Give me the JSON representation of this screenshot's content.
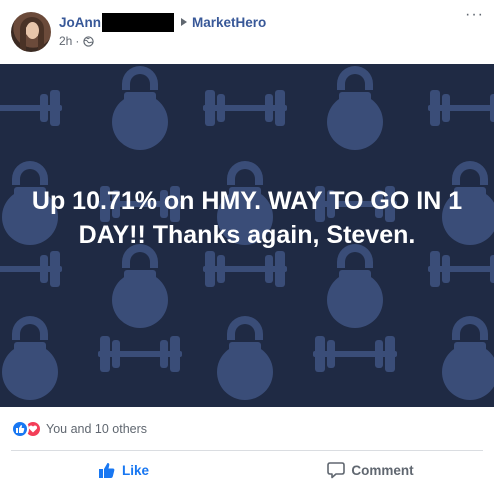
{
  "post": {
    "author": "JoAnn",
    "arrow": "▸",
    "group": "MarketHero",
    "time": "2h",
    "separator": "·",
    "more_menu": "···",
    "banner_text": "Up 10.71% on HMY. WAY TO GO IN 1 DAY!! Thanks again, Steven.",
    "reactions_text": "You and 10 others",
    "like_label": "Like",
    "comment_label": "Comment"
  },
  "colors": {
    "link": "#385898",
    "banner_bg": "#1f2a44",
    "banner_icons": "#3a4d78",
    "like_active": "#1877f2",
    "love": "#f33e58"
  },
  "icons": {
    "avatar": "profile-photo",
    "audience": "globe-icon",
    "like_reaction": "thumbs-up-icon",
    "love_reaction": "heart-icon",
    "like_button": "thumbs-up-icon",
    "comment_button": "speech-bubble-icon"
  }
}
